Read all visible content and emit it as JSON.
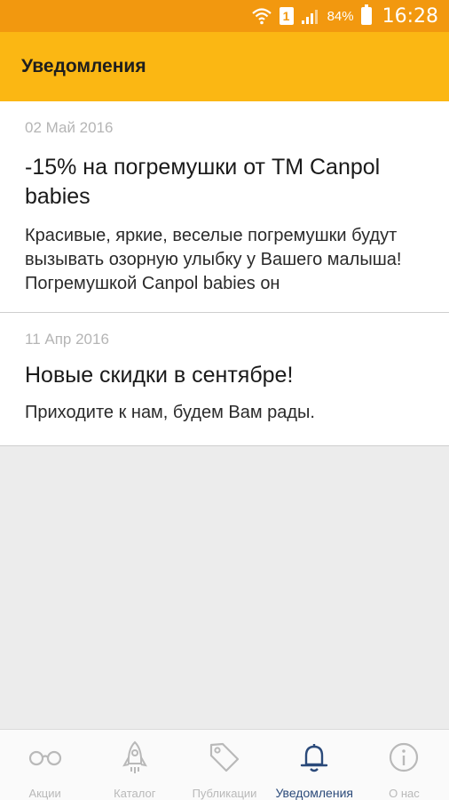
{
  "status_bar": {
    "battery": "84%",
    "time": "16:28",
    "sim": "1"
  },
  "app_bar": {
    "title": "Уведомления"
  },
  "notifications": [
    {
      "date": "02 Май 2016",
      "title": "-15% на погремушки от ТМ Canpol babies",
      "body": "Красивые, яркие, веселые погремушки будут вызывать озорную улыбку у Вашего малыша! Погремушкой Canpol babies он"
    },
    {
      "date": "11 Апр 2016",
      "title": "Новые скидки в сентябре!",
      "body": "Приходите к нам, будем Вам рады."
    }
  ],
  "bottom_nav": {
    "items": [
      {
        "label": "Акции",
        "icon": "glasses-icon"
      },
      {
        "label": "Каталог",
        "icon": "rocket-icon"
      },
      {
        "label": "Публикации",
        "icon": "tag-icon"
      },
      {
        "label": "Уведомления",
        "icon": "bell-icon",
        "active": true
      },
      {
        "label": "О нас",
        "icon": "info-icon"
      }
    ]
  },
  "colors": {
    "status_bar": "#f2980f",
    "app_bar": "#fbb713",
    "active_nav": "#2b4a7a",
    "inactive_nav": "#b9b9b9"
  }
}
